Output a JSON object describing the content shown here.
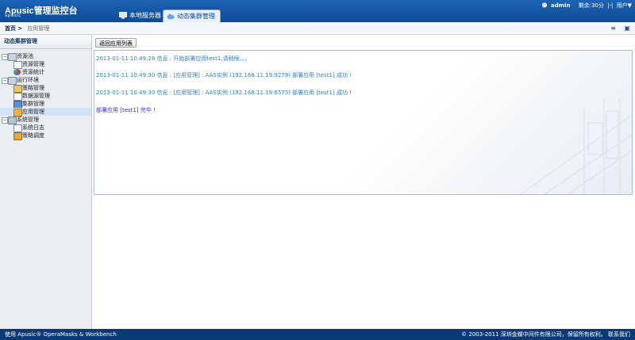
{
  "header": {
    "logo_en": "Apusic",
    "logo_cn": "管理监控台",
    "logo_sub": "apusic",
    "tabs": [
      {
        "label": "本地服务器",
        "active": false
      },
      {
        "label": "动态集群管理",
        "active": true
      }
    ],
    "user": "admin",
    "session": "剩余:30分",
    "user_menu": "用户▼",
    "separator": "|-|"
  },
  "breadcrumb": {
    "home": "首页 >",
    "current": "应用管理"
  },
  "sidebar": {
    "title": "动态集群管理",
    "groups": [
      {
        "label": "资源池",
        "items": [
          {
            "label": "资源管理"
          },
          {
            "label": "资源统计"
          }
        ]
      },
      {
        "label": "运行环境",
        "items": [
          {
            "label": "策略管理"
          },
          {
            "label": "数据源管理"
          },
          {
            "label": "集群管理"
          },
          {
            "label": "应用管理"
          }
        ]
      },
      {
        "label": "系统管理",
        "items": [
          {
            "label": "系统日志"
          },
          {
            "label": "策略调度"
          }
        ]
      }
    ]
  },
  "main": {
    "back_button": "返回应用列表",
    "log": [
      "2013-01-11 10:49:28 信息 : 开始部署应用test1,请稍候。。。",
      "2013-01-11 10:49:30 信息 : [应用管理] : AAS实例 (192.168.11.19:9279) 部署应用 [test1] 成功 !",
      "2013-01-11 10:49:30 信息 : [应用管理] : AAS实例 (192.168.11.19:6575) 部署应用 [test1] 成功 !",
      "部署应用 [test1] 完毕 !"
    ]
  },
  "footer": {
    "left": "使用 Apusic® OperaMasks & Workbench",
    "right": "© 2003-2011 深圳金蝶中间件有限公司，保留所有权利。 联系我们"
  },
  "colors": {
    "header_blue": "#0d4a94",
    "footer_blue": "#0b3a78",
    "log_text": "#2f7fc3",
    "log_final": "#4a2be2"
  }
}
